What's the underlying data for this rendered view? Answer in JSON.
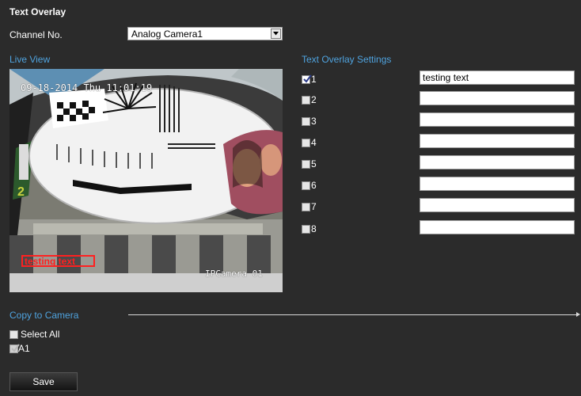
{
  "page_title": "Text Overlay",
  "channel": {
    "label": "Channel No.",
    "selected": "Analog Camera1"
  },
  "live_view": {
    "label": "Live View",
    "osd_datetime": "09-18-2014 Thu 11:01:19",
    "osd_overlay_text": "testing text",
    "osd_camera_name": "IPCamera 01"
  },
  "overlay_settings": {
    "label": "Text Overlay Settings",
    "rows": [
      {
        "num": "1",
        "checked": true,
        "value": "testing text"
      },
      {
        "num": "2",
        "checked": false,
        "value": ""
      },
      {
        "num": "3",
        "checked": false,
        "value": ""
      },
      {
        "num": "4",
        "checked": false,
        "value": ""
      },
      {
        "num": "5",
        "checked": false,
        "value": ""
      },
      {
        "num": "6",
        "checked": false,
        "value": ""
      },
      {
        "num": "7",
        "checked": false,
        "value": ""
      },
      {
        "num": "8",
        "checked": false,
        "value": ""
      }
    ]
  },
  "copy_to_camera": {
    "label": "Copy to Camera",
    "select_all": {
      "label": "Select All",
      "checked": false
    },
    "cameras": [
      {
        "label": "A1",
        "checked": true,
        "disabled": true
      }
    ]
  },
  "save_label": "Save",
  "colors": {
    "background": "#2b2b2b",
    "section_label": "#4fa3df",
    "osd_red": "#ff2020"
  }
}
